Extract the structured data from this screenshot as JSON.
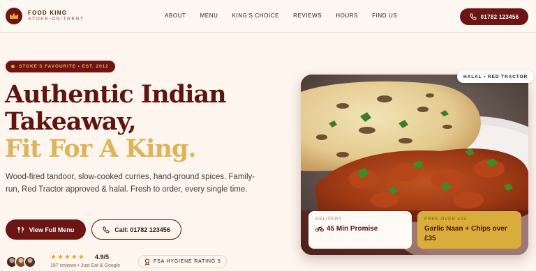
{
  "brand": {
    "name": "FOOD KING",
    "location": "STOKE-ON-TRENT",
    "logo_icon": "crown-icon"
  },
  "nav": {
    "links": [
      "ABOUT",
      "MENU",
      "KING'S CHOICE",
      "REVIEWS",
      "HOURS",
      "FIND US"
    ],
    "call_label": "01782 123456",
    "call_icon": "phone-icon"
  },
  "hero": {
    "pill": "STOKE'S FAVOURITE • EST. 2012",
    "headline": [
      "Authentic Indian",
      "Takeaway,",
      "Fit For A King."
    ],
    "lede": "Wood-fired tandoor, slow-cooked curries, hand-ground spices. Family-run, Red Tractor approved & halal. Fresh to order, every single time.",
    "primary_button": "View Full Menu",
    "secondary_button": "Call: 01782 123456",
    "rating": "4.9/5",
    "stars": 5,
    "reviews": "187 reviews • Just Eat & Google",
    "fsa": "FSA HYGIENE RATING 5"
  },
  "image_panel": {
    "badge": "HALAL • RED TRACTOR",
    "delivery_label": "DELIVERY",
    "delivery_value": "45 Min Promise",
    "offer_label": "FREE OVER £25",
    "offer_value": "Garlic Naan + Chips over £35"
  },
  "colors": {
    "brand": "#6d1414",
    "gold": "#dcb45a",
    "offer": "#d9ad3a",
    "background": "#fdf5ee"
  }
}
